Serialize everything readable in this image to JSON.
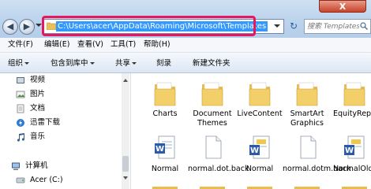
{
  "window": {
    "close_glyph": "X",
    "nav": {
      "back_glyph": "◀",
      "forward_glyph": "▶"
    },
    "address": {
      "path": "C:\\Users\\acer\\AppData\\Roaming\\Microsoft\\Templates"
    },
    "refresh_glyph": "↻",
    "search": {
      "placeholder": "搜索 Templates"
    }
  },
  "menu": {
    "items": [
      {
        "label": "文件(F)"
      },
      {
        "label": "编辑(E)"
      },
      {
        "label": "查看(V)"
      },
      {
        "label": "工具(T)"
      },
      {
        "label": "帮助(H)"
      }
    ]
  },
  "toolbar": {
    "organize": "组织",
    "include_in_library": "包含到库中",
    "share": "共享",
    "burn": "刻录",
    "new_folder": "新建文件夹"
  },
  "sidebar": {
    "items": [
      {
        "label": "视频",
        "icon": "video-library-icon"
      },
      {
        "label": "图片",
        "icon": "pictures-library-icon"
      },
      {
        "label": "文档",
        "icon": "documents-library-icon"
      },
      {
        "label": "迅雷下载",
        "icon": "thunder-download-icon"
      },
      {
        "label": "音乐",
        "icon": "music-library-icon"
      }
    ],
    "computer_label": "计算机",
    "drive_label": "Acer (C:)"
  },
  "files": {
    "row1": [
      {
        "label": "Charts",
        "icon": "folder-icon"
      },
      {
        "label": "Document Themes",
        "icon": "folder-icon"
      },
      {
        "label": "LiveContent",
        "icon": "folder-icon"
      },
      {
        "label": "SmartArt Graphics",
        "icon": "folder-icon"
      },
      {
        "label": "EquityReport",
        "icon": "folder-icon"
      }
    ],
    "row2": [
      {
        "label": "Normal",
        "icon": "word-document-icon"
      },
      {
        "label": "normal.dot.back",
        "icon": "blank-file-icon"
      },
      {
        "label": "Normal",
        "icon": "word-template-icon"
      },
      {
        "label": "normal.dotm.back",
        "icon": "blank-file-icon"
      },
      {
        "label": "NormalOld",
        "icon": "word-template-icon"
      }
    ]
  },
  "colors": {
    "highlight_border": "#e8175d",
    "selection": "#3399ff"
  }
}
